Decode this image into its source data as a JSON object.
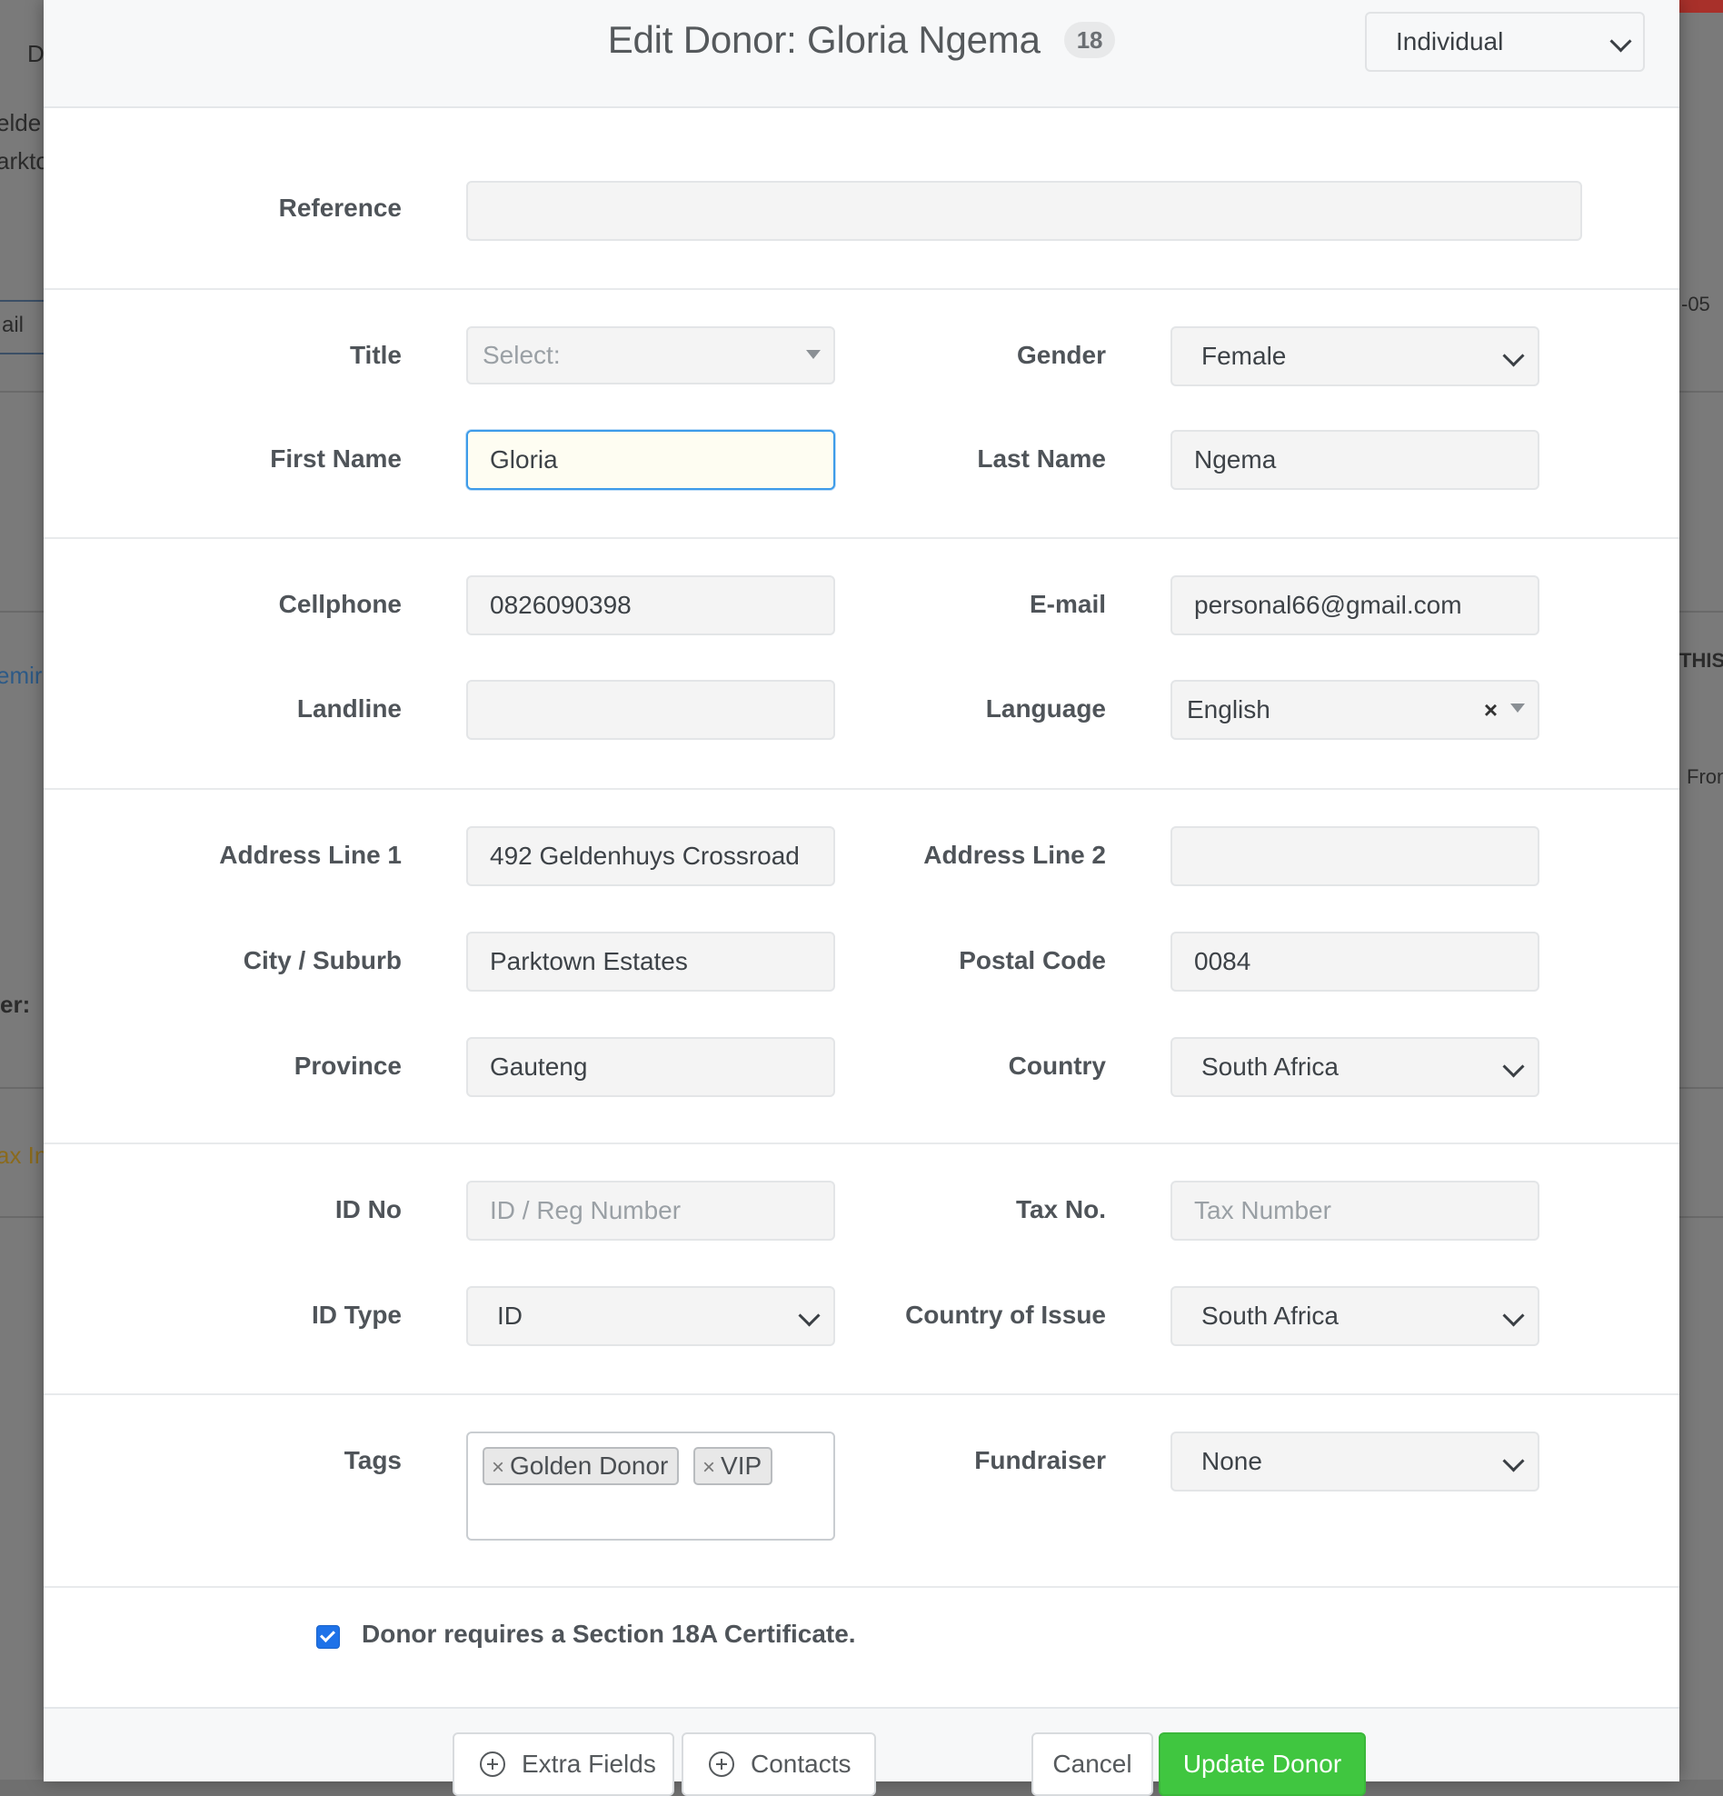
{
  "background": {
    "fragments": [
      "D",
      "elde",
      "arkto",
      "ail",
      "-05",
      "THIS",
      "emir",
      "Fron",
      "er:",
      "ax Inf"
    ]
  },
  "header": {
    "title": "Edit Donor: Gloria Ngema",
    "badge": "18",
    "donor_type": "Individual"
  },
  "reference": {
    "label": "Reference",
    "value": ""
  },
  "personal": {
    "title_label": "Title",
    "title_placeholder": "Select:",
    "gender_label": "Gender",
    "gender_value": "Female",
    "first_name_label": "First Name",
    "first_name_value": "Gloria",
    "last_name_label": "Last Name",
    "last_name_value": "Ngema"
  },
  "contact": {
    "cellphone_label": "Cellphone",
    "cellphone_value": "0826090398",
    "email_label": "E-mail",
    "email_value": "personal66@gmail.com",
    "landline_label": "Landline",
    "landline_value": "",
    "language_label": "Language",
    "language_value": "English",
    "language_clear": "×"
  },
  "address": {
    "line1_label": "Address Line 1",
    "line1_value": "492 Geldenhuys Crossroad",
    "line2_label": "Address Line 2",
    "line2_value": "",
    "city_label": "City / Suburb",
    "city_value": "Parktown Estates",
    "postal_label": "Postal Code",
    "postal_value": "0084",
    "province_label": "Province",
    "province_value": "Gauteng",
    "country_label": "Country",
    "country_value": "South Africa"
  },
  "identity": {
    "id_no_label": "ID No",
    "id_no_placeholder": "ID / Reg Number",
    "tax_no_label": "Tax No.",
    "tax_no_placeholder": "Tax Number",
    "id_type_label": "ID Type",
    "id_type_value": "ID",
    "country_issue_label": "Country of Issue",
    "country_issue_value": "South Africa"
  },
  "tagging": {
    "tags_label": "Tags",
    "tags": [
      "Golden Donor",
      "VIP"
    ],
    "tag_remove": "×",
    "fundraiser_label": "Fundraiser",
    "fundraiser_value": "None"
  },
  "certificate": {
    "checked": true,
    "label": "Donor requires a Section 18A Certificate."
  },
  "footer": {
    "extra_fields": "Extra Fields",
    "contacts": "Contacts",
    "cancel": "Cancel",
    "update": "Update Donor"
  },
  "colors": {
    "primary_button": "#40c640",
    "focus_border": "#3d9be9",
    "checkbox": "#1e72e8"
  }
}
